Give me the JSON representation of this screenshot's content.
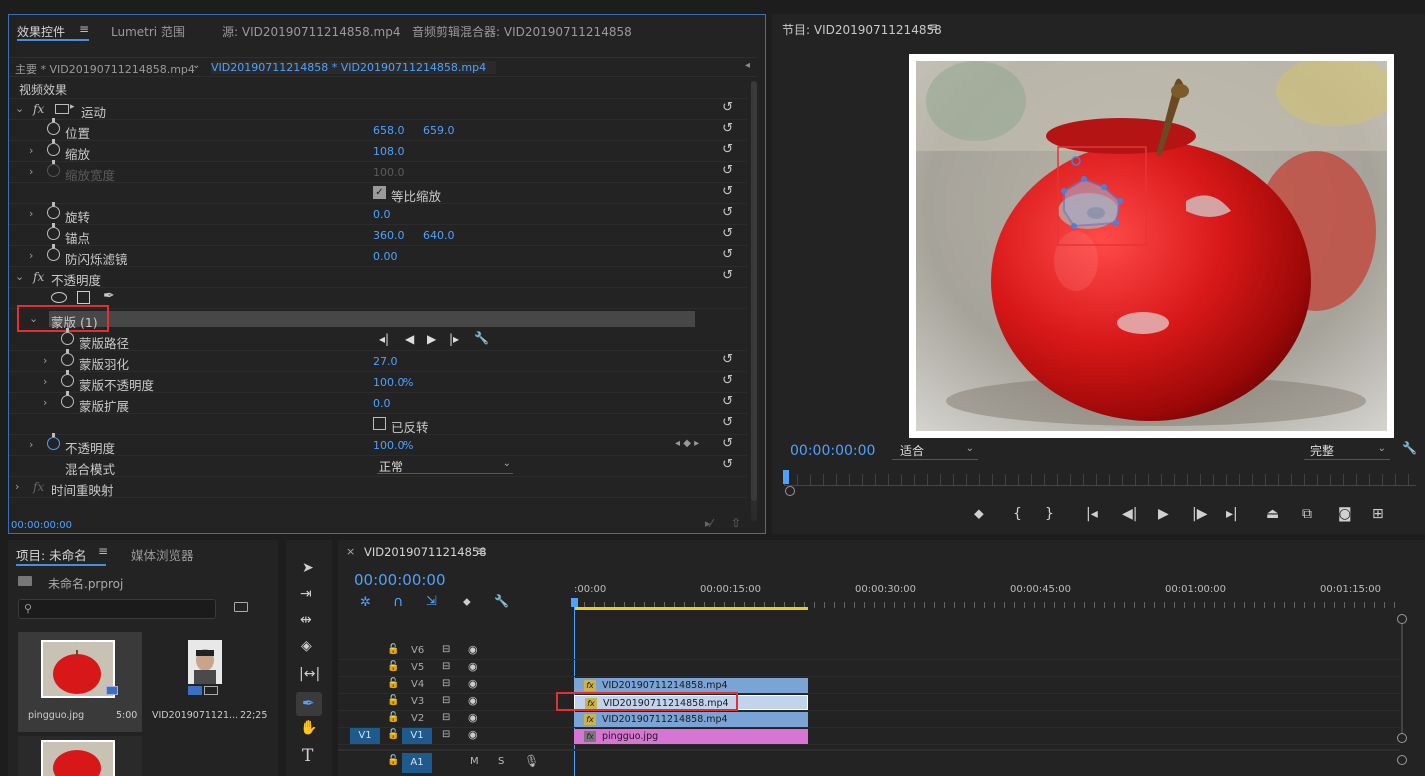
{
  "effect_controls": {
    "tabs": [
      "效果控件",
      "Lumetri 范围",
      "源: VID20190711214858.mp4",
      "音频剪辑混合器: VID20190711214858"
    ],
    "master_clip": "主要 * VID20190711214858.mp4",
    "sequence_clip": "VID20190711214858 * VID20190711214858.mp4",
    "section_video": "视频效果",
    "motion": "运动",
    "position_label": "位置",
    "position_x": "658.0",
    "position_y": "659.0",
    "scale_label": "缩放",
    "scale_value": "108.0",
    "scale_width_label": "缩放宽度",
    "scale_width_value": "100.0",
    "uniform_scale": "等比缩放",
    "rotation_label": "旋转",
    "rotation_value": "0.0",
    "anchor_label": "锚点",
    "anchor_x": "360.0",
    "anchor_y": "640.0",
    "flicker_label": "防闪烁滤镜",
    "flicker_value": "0.00",
    "opacity_section": "不透明度",
    "mask_label": "蒙版 (1)",
    "mask_path": "蒙版路径",
    "mask_feather_label": "蒙版羽化",
    "mask_feather_value": "27.0",
    "mask_opacity_label": "蒙版不透明度",
    "mask_opacity_value": "100.0",
    "mask_expand_label": "蒙版扩展",
    "mask_expand_value": "0.0",
    "inverted": "已反转",
    "opacity_label": "不透明度",
    "opacity_value": "100.0",
    "percent": "%",
    "blend_label": "混合模式",
    "blend_value": "正常",
    "time_remap": "时间重映射",
    "timecode": "00:00:00:00"
  },
  "program": {
    "title": "节目: VID20190711214858",
    "timecode": "00:00:00:00",
    "fit": "适合",
    "quality": "完整"
  },
  "project": {
    "tab1": "项目: 未命名",
    "tab2": "媒体浏览器",
    "file": "未命名.prproj",
    "items": [
      {
        "name": "pingguo.jpg",
        "duration": "5:00"
      },
      {
        "name": "VID2019071121...",
        "duration": "22;25"
      }
    ]
  },
  "timeline": {
    "sequence": "VID20190711214858",
    "timecode": "00:00:00:00",
    "ruler": [
      ":00:00",
      "00:00:15:00",
      "00:00:30:00",
      "00:00:45:00",
      "00:01:00:00",
      "00:01:15:00"
    ],
    "tracks": [
      "V6",
      "V5",
      "V4",
      "V3",
      "V2",
      "V1",
      "A1"
    ],
    "src_patch_v": "V1",
    "src_patch_a": "A1",
    "m": "M",
    "s": "S",
    "clips": [
      {
        "track": "V4",
        "name": "VID20190711214858.mp4"
      },
      {
        "track": "V3",
        "name": "VID20190711214858.mp4"
      },
      {
        "track": "V2",
        "name": "VID20190711214858.mp4"
      },
      {
        "track": "V1",
        "name": "pingguo.jpg"
      }
    ]
  },
  "colors": {
    "accent": "#4ea1ff",
    "highlight": "#e03030",
    "clip_video": "#7aa3d6",
    "clip_image": "#d675d4"
  }
}
